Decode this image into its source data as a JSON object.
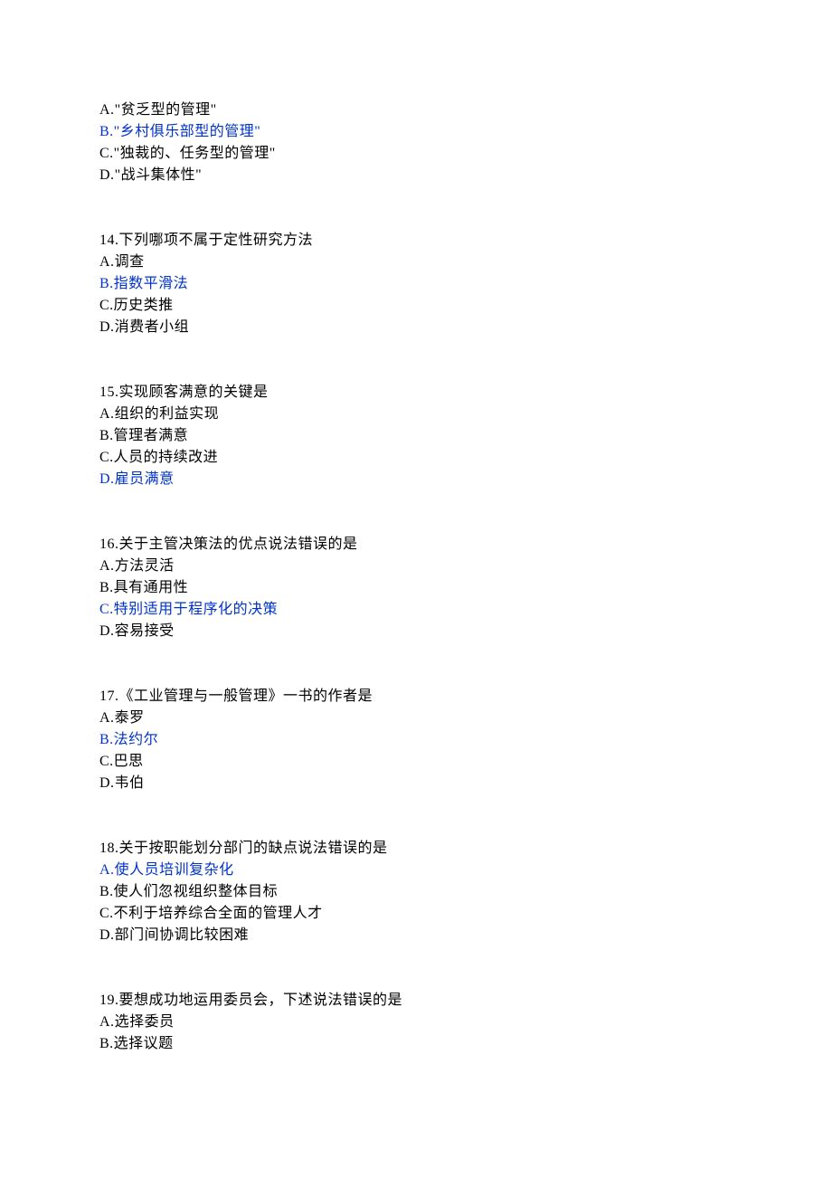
{
  "q13_partial": {
    "options": [
      {
        "label": "A.",
        "text": "\"贫乏型的管理\"",
        "highlight": false
      },
      {
        "label": "B.",
        "text": "\"乡村俱乐部型的管理\"",
        "highlight": true
      },
      {
        "label": "C.",
        "text": "\"独裁的、任务型的管理\"",
        "highlight": false
      },
      {
        "label": "D.",
        "text": "\"战斗集体性\"",
        "highlight": false
      }
    ]
  },
  "questions": [
    {
      "number": "14.",
      "stem": "下列哪项不属于定性研究方法",
      "options": [
        {
          "label": "A.",
          "text": "调查",
          "highlight": false
        },
        {
          "label": "B.",
          "text": "指数平滑法",
          "highlight": true
        },
        {
          "label": "C.",
          "text": "历史类推",
          "highlight": false
        },
        {
          "label": "D.",
          "text": "消费者小组",
          "highlight": false
        }
      ]
    },
    {
      "number": "15.",
      "stem": "实现顾客满意的关键是",
      "options": [
        {
          "label": "A.",
          "text": "组织的利益实现",
          "highlight": false
        },
        {
          "label": "B.",
          "text": "管理者满意",
          "highlight": false
        },
        {
          "label": "C.",
          "text": "人员的持续改进",
          "highlight": false
        },
        {
          "label": "D.",
          "text": "雇员满意",
          "highlight": true
        }
      ]
    },
    {
      "number": "16.",
      "stem": "关于主管决策法的优点说法错误的是",
      "options": [
        {
          "label": "A.",
          "text": "方法灵活",
          "highlight": false
        },
        {
          "label": "B.",
          "text": "具有通用性",
          "highlight": false
        },
        {
          "label": "C.",
          "text": "特别适用于程序化的决策",
          "highlight": true
        },
        {
          "label": "D.",
          "text": "容易接受",
          "highlight": false
        }
      ]
    },
    {
      "number": "17.",
      "stem": "《工业管理与一般管理》一书的作者是",
      "options": [
        {
          "label": "A.",
          "text": "泰罗",
          "highlight": false
        },
        {
          "label": "B.",
          "text": "法约尔",
          "highlight": true
        },
        {
          "label": "C.",
          "text": "巴思",
          "highlight": false
        },
        {
          "label": "D.",
          "text": "韦伯",
          "highlight": false
        }
      ]
    },
    {
      "number": "18.",
      "stem": "关于按职能划分部门的缺点说法错误的是",
      "options": [
        {
          "label": "A.",
          "text": "使人员培训复杂化",
          "highlight": true
        },
        {
          "label": "B.",
          "text": "使人们忽视组织整体目标",
          "highlight": false
        },
        {
          "label": "C.",
          "text": "不利于培养综合全面的管理人才",
          "highlight": false
        },
        {
          "label": "D.",
          "text": "部门间协调比较困难",
          "highlight": false
        }
      ]
    },
    {
      "number": "19.",
      "stem": "要想成功地运用委员会，下述说法错误的是",
      "options": [
        {
          "label": "A.",
          "text": "选择委员",
          "highlight": false
        },
        {
          "label": "B.",
          "text": "选择议题",
          "highlight": false
        }
      ]
    }
  ]
}
